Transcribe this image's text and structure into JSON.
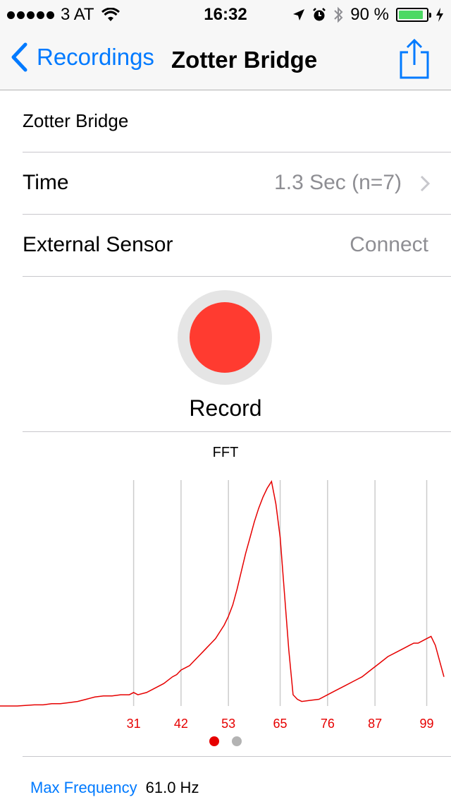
{
  "status_bar": {
    "carrier": "3 AT",
    "time": "16:32",
    "battery_percent": "90 %",
    "battery_level": 0.9,
    "icons": [
      "signal-dots",
      "wifi-icon",
      "location-icon",
      "alarm-icon",
      "bluetooth-icon",
      "battery-icon",
      "charging-icon"
    ]
  },
  "nav": {
    "back_label": "Recordings",
    "title": "Zotter Bridge",
    "share_icon": "share-icon",
    "accent_color": "#007aff"
  },
  "rows": {
    "name": "Zotter Bridge",
    "time_label": "Time",
    "time_value": "1.3 Sec (n=7)",
    "sensor_label": "External Sensor",
    "sensor_action": "Connect"
  },
  "record": {
    "label": "Record",
    "button_color": "#ff3b30"
  },
  "chart_data": {
    "type": "line",
    "title": "FFT",
    "xlabel": "",
    "ylabel": "",
    "x_ticks": [
      31,
      42,
      53,
      65,
      76,
      87,
      99
    ],
    "xlim": [
      0,
      103
    ],
    "ylim": [
      0,
      1
    ],
    "grid": "vertical",
    "line_color": "#e60000",
    "x": [
      0,
      4,
      8,
      10,
      12,
      14,
      16,
      18,
      20,
      22,
      24,
      26,
      28,
      30,
      31,
      32,
      34,
      36,
      38,
      40,
      41,
      42,
      43,
      44,
      45,
      46,
      47,
      48,
      49,
      50,
      51,
      52,
      53,
      54,
      55,
      56,
      57,
      58,
      59,
      60,
      61,
      62,
      63,
      64,
      65,
      66,
      67,
      68,
      69,
      70,
      72,
      74,
      76,
      78,
      80,
      82,
      84,
      86,
      88,
      90,
      92,
      94,
      95,
      96,
      97,
      98,
      99,
      100,
      101,
      102,
      103
    ],
    "y": [
      0,
      0,
      0.005,
      0.005,
      0.01,
      0.01,
      0.015,
      0.02,
      0.03,
      0.04,
      0.045,
      0.045,
      0.05,
      0.05,
      0.06,
      0.05,
      0.06,
      0.08,
      0.1,
      0.13,
      0.14,
      0.16,
      0.17,
      0.18,
      0.2,
      0.22,
      0.24,
      0.26,
      0.28,
      0.3,
      0.33,
      0.36,
      0.4,
      0.45,
      0.52,
      0.6,
      0.68,
      0.75,
      0.82,
      0.88,
      0.93,
      0.97,
      1.0,
      0.9,
      0.75,
      0.5,
      0.25,
      0.05,
      0.03,
      0.02,
      0.025,
      0.03,
      0.05,
      0.07,
      0.09,
      0.11,
      0.13,
      0.16,
      0.19,
      0.22,
      0.24,
      0.26,
      0.27,
      0.28,
      0.28,
      0.29,
      0.3,
      0.31,
      0.27,
      0.2,
      0.13
    ]
  },
  "pager": {
    "count": 2,
    "active_index": 0
  },
  "max_frequency": {
    "label": "Max Frequency",
    "value": "61.0 Hz"
  }
}
